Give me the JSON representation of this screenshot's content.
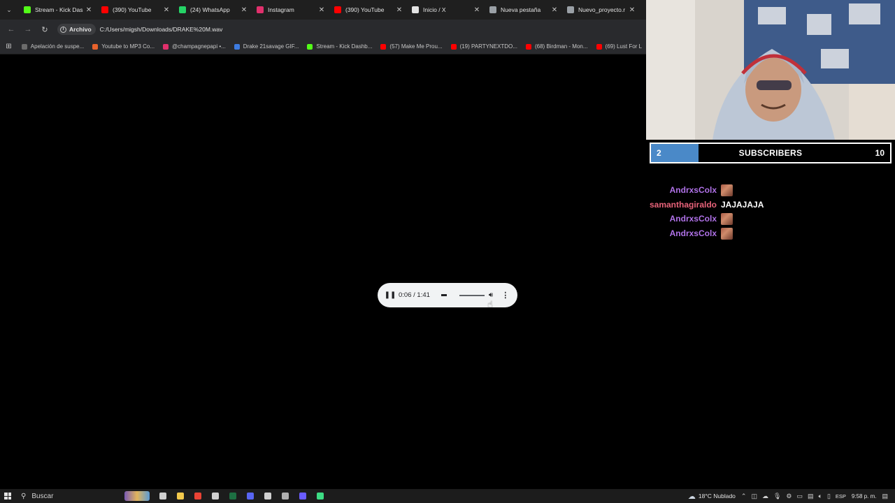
{
  "browser": {
    "tabs": [
      {
        "title": "Stream - Kick Das",
        "icon": "kick-icon",
        "color": "#53fc18"
      },
      {
        "title": "(390) YouTube",
        "icon": "youtube-icon",
        "color": "#ff0000"
      },
      {
        "title": "(24) WhatsApp",
        "icon": "whatsapp-icon",
        "color": "#25d366"
      },
      {
        "title": "Instagram",
        "icon": "instagram-icon",
        "color": "#e1306c"
      },
      {
        "title": "(390) YouTube",
        "icon": "youtube-icon",
        "color": "#ff0000"
      },
      {
        "title": "Inicio / X",
        "icon": "x-icon",
        "color": "#e3e3e3"
      },
      {
        "title": "Nueva pestaña",
        "icon": "chrome-icon",
        "color": "#9aa0a6"
      },
      {
        "title": "Nuevo_proyecto.r",
        "icon": "globe-icon",
        "color": "#9aa0a6"
      }
    ],
    "close_glyph": "✕",
    "address": {
      "chip_label": "Archivo",
      "url": "C:/Users/migsh/Downloads/DRAKE%20M.wav"
    },
    "bookmarks": [
      {
        "label": "Apelación de suspe...",
        "color": "#6b6b6b"
      },
      {
        "label": "Youtube to MP3 Co...",
        "color": "#e8622c"
      },
      {
        "label": "@champagnepapi •...",
        "color": "#e1306c"
      },
      {
        "label": "Drake 21savage GIF...",
        "color": "#3d7be0"
      },
      {
        "label": "Stream - Kick Dashb...",
        "color": "#53fc18"
      },
      {
        "label": "(57) Make Me Prou...",
        "color": "#ff0000"
      },
      {
        "label": "(19) PARTYNEXTDO...",
        "color": "#ff0000"
      },
      {
        "label": "(68) Birdman - Mon...",
        "color": "#ff0000"
      },
      {
        "label": "(69) Lust For L",
        "color": "#ff0000"
      }
    ]
  },
  "player": {
    "time": "0:06 / 1:41",
    "progress_fraction": 0.06,
    "volume_fraction": 1.0
  },
  "overlay": {
    "subs": {
      "current": "2",
      "label": "SUBSCRIBERS",
      "goal": "10",
      "progress_fraction": 0.2,
      "fill_color": "#4a89c8"
    },
    "chat": [
      {
        "user": "AndrxsColx",
        "user_color": "#b072e8",
        "message": "",
        "emote": true
      },
      {
        "user": "samanthagiraldo",
        "user_color": "#e8637a",
        "message": "JAJAJAJA",
        "emote": false
      },
      {
        "user": "AndrxsColx",
        "user_color": "#b072e8",
        "message": "",
        "emote": true
      },
      {
        "user": "AndrxsColx",
        "user_color": "#b072e8",
        "message": "",
        "emote": true
      }
    ]
  },
  "taskbar": {
    "search_placeholder": "Buscar",
    "apps": [
      {
        "name": "task-view-icon",
        "color": "#d0d0d0"
      },
      {
        "name": "file-explorer-icon",
        "color": "#f2c94c"
      },
      {
        "name": "chrome-icon",
        "color": "#ea4335"
      },
      {
        "name": "notepad-icon",
        "color": "#d0d0d0"
      },
      {
        "name": "excel-icon",
        "color": "#1d6f42"
      },
      {
        "name": "discord-icon",
        "color": "#5865f2"
      },
      {
        "name": "streamer-app-icon",
        "color": "#d0d0d0"
      },
      {
        "name": "obs-icon",
        "color": "#b0b0b0"
      },
      {
        "name": "browser-icon",
        "color": "#6a5cff"
      },
      {
        "name": "terminal-icon",
        "color": "#3ddc84"
      }
    ],
    "weather": "18°C  Nublado",
    "language": "ESP",
    "clock": "9:58 p. m."
  }
}
